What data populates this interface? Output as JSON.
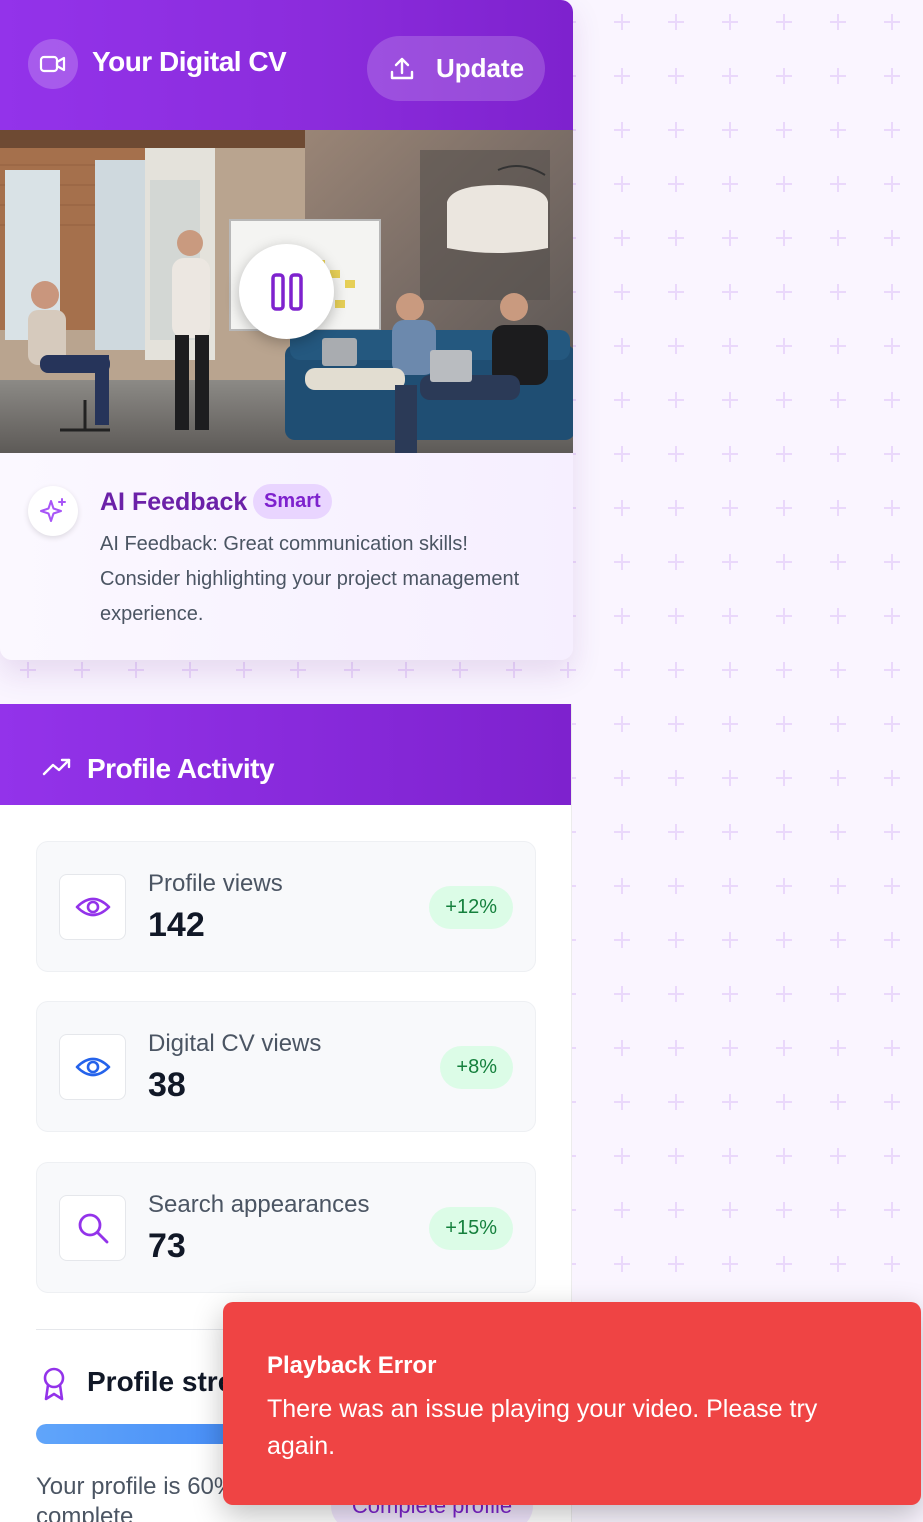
{
  "header": {
    "title": "Your Digital CV",
    "update_label": "Update"
  },
  "video": {
    "state": "playing",
    "control_icon": "pause-icon"
  },
  "feedback": {
    "title": "AI Feedback",
    "badge": "Smart",
    "text": "AI Feedback: Great communication skills! Consider highlighting your project management experience."
  },
  "activity": {
    "title": "Profile Activity",
    "stats": [
      {
        "label": "Profile views",
        "value": "142",
        "change": "+12%",
        "icon": "eye-icon",
        "icon_color": "#9333ea"
      },
      {
        "label": "Digital CV views",
        "value": "38",
        "change": "+8%",
        "icon": "eye-icon",
        "icon_color": "#2563eb"
      },
      {
        "label": "Search appearances",
        "value": "73",
        "change": "+15%",
        "icon": "search-icon",
        "icon_color": "#9333ea"
      }
    ]
  },
  "strength": {
    "title": "Profile strength",
    "progress": 0.6,
    "text": "Your profile is 60% complete",
    "button": "Complete profile"
  },
  "toast": {
    "title": "Playback Error",
    "message": "There was an issue playing your video. Please try again."
  },
  "colors": {
    "brand": "#9333ea",
    "error": "#ef4444",
    "positive": "#15803d"
  }
}
